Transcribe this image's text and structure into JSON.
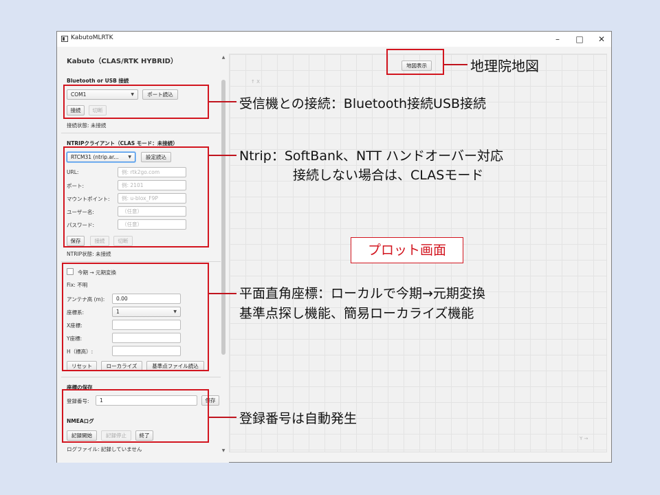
{
  "window": {
    "title": "KabutoMLRTK",
    "minimize_glyph": "–",
    "maximize_glyph": "□",
    "close_glyph": "✕"
  },
  "panel": {
    "app_title": "Kabuto（CLAS/RTK HYBRID）",
    "bluetooth": {
      "section_title": "Bluetooth or USB 接続",
      "port_value": "COM1",
      "port_read_button": "ポート読込",
      "connect_button": "接続",
      "disconnect_button": "切断",
      "status": "接続状態: 未接続"
    },
    "ntrip": {
      "section_title": "NTRIPクライアント（CLAS モード：未接続）",
      "profile_value": "RTCM31 (ntrip.ar...",
      "settings_read_button": "設定読込",
      "url_label": "URL:",
      "url_placeholder": "例: rtk2go.com",
      "port_label": "ポート:",
      "port_placeholder": "例: 2101",
      "mount_label": "マウントポイント:",
      "mount_placeholder": "例: u-blox_F9P",
      "user_label": "ユーザー名:",
      "user_placeholder": "（任意）",
      "password_label": "パスワード:",
      "password_placeholder": "（任意）",
      "save_button": "保存",
      "connect_button": "接続",
      "disconnect_button": "切断",
      "status": "NTRIP状態: 未接続"
    },
    "coords": {
      "convert_label": "今期 → 元期変換",
      "fix_text": "Fix: 不明",
      "antenna_label": "アンテナ高 (m):",
      "antenna_value": "0.00",
      "system_label": "座標系:",
      "system_value": "1",
      "x_label": "X座標:",
      "y_label": "Y座標:",
      "h_label": "H（標高）:",
      "reset_button": "リセット",
      "localize_button": "ローカライズ",
      "benchmark_button": "基準点ファイル読込"
    },
    "save_coords": {
      "section_title": "座標の保存",
      "reg_label": "登録番号:",
      "reg_value": "1",
      "save_button": "保存"
    },
    "nmea": {
      "section_title": "NMEAログ",
      "start_button": "記録開始",
      "stop_button": "記録停止",
      "end_button": "終了",
      "status": "ログファイル: 記録していません"
    }
  },
  "plot": {
    "map_button": "地図表示",
    "axis_x": "↑ X",
    "axis_y": "Y →"
  },
  "annotations": {
    "map": "地理院地図",
    "receiver": "受信機との接続：Bluetooth接続USB接続",
    "ntrip_line1": "Ntrip：SoftBank、NTT ハンドオーバー対応",
    "ntrip_line2": "接続しない場合は、CLASモード",
    "plot": "プロット画面",
    "coords_line1": "平面直角座標：ローカルで今期→元期変換",
    "coords_line2": "基準点探し機能、簡易ローカライズ機能",
    "reg": "登録番号は自動発生"
  },
  "colors": {
    "slide_background": "#dae3f3",
    "callout_red": "#d2141e",
    "focus_blue": "#3d8ee8"
  }
}
